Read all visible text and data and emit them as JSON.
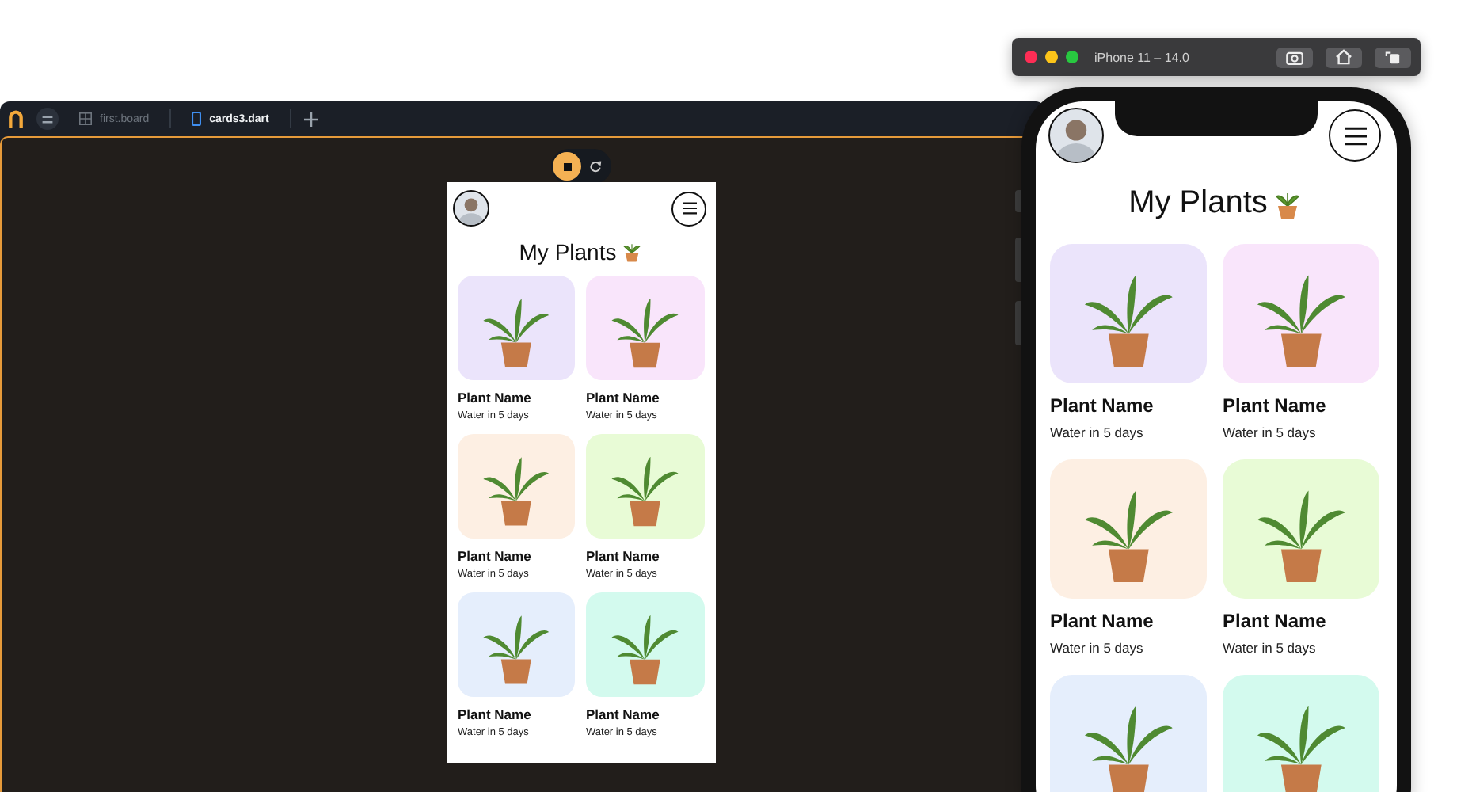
{
  "editor": {
    "tabs": [
      {
        "label": "first.board",
        "kind": "board",
        "selected": false
      },
      {
        "label": "cards3.dart",
        "kind": "phone",
        "selected": true
      }
    ]
  },
  "preview": {
    "title": "My Plants",
    "plants": [
      {
        "name": "Plant Name",
        "subtitle": "Water in 5 days",
        "color": "#ebe4fb"
      },
      {
        "name": "Plant Name",
        "subtitle": "Water in 5 days",
        "color": "#f9e5fb"
      },
      {
        "name": "Plant Name",
        "subtitle": "Water in 5 days",
        "color": "#fdefe3"
      },
      {
        "name": "Plant Name",
        "subtitle": "Water in 5 days",
        "color": "#e8fbd6"
      },
      {
        "name": "Plant Name",
        "subtitle": "Water in 5 days",
        "color": "#e5eefc"
      },
      {
        "name": "Plant Name",
        "subtitle": "Water in 5 days",
        "color": "#d3faee"
      }
    ]
  },
  "simulator": {
    "title": "iPhone 11 – 14.0",
    "screen_title": "My Plants",
    "plants": [
      {
        "name": "Plant Name",
        "subtitle": "Water in 5 days",
        "color": "#ebe4fb"
      },
      {
        "name": "Plant Name",
        "subtitle": "Water in 5 days",
        "color": "#f9e5fb"
      },
      {
        "name": "Plant Name",
        "subtitle": "Water in 5 days",
        "color": "#fdefe3"
      },
      {
        "name": "Plant Name",
        "subtitle": "Water in 5 days",
        "color": "#e8fbd6"
      },
      {
        "color": "#e5eefc"
      },
      {
        "color": "#d3faee"
      }
    ]
  }
}
